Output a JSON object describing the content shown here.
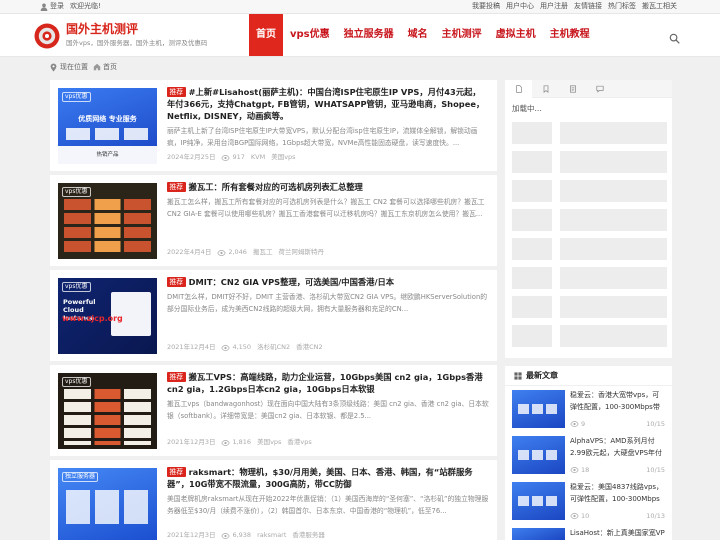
{
  "colors": {
    "accent": "#d7261b",
    "nav_active_bg": "#e0271d",
    "badge_bg": "#d9251c"
  },
  "topbar": {
    "login": "登录",
    "welcome": "欢迎光临!",
    "links": [
      "我要投稿",
      "用户中心",
      "用户注册",
      "友情链接",
      "热门标签",
      "搬瓦工相关"
    ]
  },
  "site": {
    "title": "国外主机测评",
    "subtitle": "国外vps，国外服务器，国外主机，测评及优惠码"
  },
  "nav": [
    "首页",
    "vps优惠",
    "独立服务器",
    "域名",
    "主机测评",
    "虚拟主机",
    "主机教程"
  ],
  "breadcrumb": {
    "label": "现在位置",
    "home": "首页"
  },
  "posts": [
    {
      "badge": "推荐",
      "title": "#上新#Lisahost(丽萨主机)：中国台湾ISP住宅原生IP VPS，月付43元起，年付366元，支持Chatgpt, FB管钥，WHATSAPP管钥，亚马逊电商，Shopee，Netflix, DISNEY，动画疯等。",
      "excerpt": "丽萨主机上新了台湾ISP住宅原生IP大带宽VPS，默认分配台湾isp住宅原生IP，流媒体全解锁，解锁动画疯，IP纯净，采用台湾BGP国际网络，1Gbps超大带宽，NVMe高性能固态硬盘，读写速度快。...",
      "date": "2024年2月25日",
      "views": "917",
      "tags": [
        "KVM",
        "美国vps"
      ],
      "thumb": {
        "label": "vps优惠",
        "headline": "优质网络 专业服务",
        "footer": "热销产品"
      }
    },
    {
      "badge": "推荐",
      "title": "搬瓦工：所有套餐对应的可选机房列表汇总整理",
      "excerpt": "搬瓦工怎么样，搬瓦工所有套餐对应的可选机房列表是什么？搬瓦工 CN2 套餐可以选择哪些机房？搬瓦工 CN2 GIA-E 套餐可以使用哪些机房？搬瓦工香港套餐可以迁移机房吗？搬瓦工东京机房怎么使用？搬瓦...",
      "date": "2022年4月4日",
      "views": "2,046",
      "tags": [
        "搬瓦工",
        "荷兰阿姆斯特丹"
      ],
      "thumb": {
        "label": "vps优惠"
      }
    },
    {
      "badge": "推荐",
      "title": "DMIT：CN2 GIA VPS整理，可选美国/中国香港/日本",
      "excerpt": "DMIT怎么样，DMIT好不好，DMIT 主营香港、洛杉矶大带宽CN2 GIA VPS。继欧鹏HKServerSolution的部分国际业务后，成为美西CN2线路的超级大网，拥有大量服务器和充足的CN...",
      "date": "2021年12月4日",
      "views": "4,150",
      "tags": [
        "洛杉矶CN2",
        "香港CN2"
      ],
      "thumb": {
        "label": "vps优惠",
        "headline": "Powerful Cloud Instance",
        "url": "www.zjcp.org"
      }
    },
    {
      "badge": "推荐",
      "title": "搬瓦工VPS：高端线路，助力企业运营，10Gbps美国 cn2 gia，1Gbps香港cn2 gia，1.2Gbps日本cn2 gia，10Gbps日本软银",
      "excerpt": "搬瓦工vps（bandwagonhost）现在面向中国大陆有3条顶级线路：美国 cn2 gia、香港 cn2 gia、日本软银（softbank）。详细带宽是：美国cn2 gia、日本软银、都是2.5...",
      "date": "2021年12月3日",
      "views": "1,816",
      "tags": [
        "美国vps",
        "香港vps"
      ],
      "thumb": {
        "label": "vps优惠"
      }
    },
    {
      "badge": "推荐",
      "title": "raksmart：物理机，$30/月用美，美国、日本、香港、韩国，有“站群服务器”，10G带宽不限流量，300G高防，带CC防御",
      "excerpt": "美国老牌机房raksmart从现在开始2022年优惠促销：（1）美国西海岸的“圣何塞”、“洛杉矶”的独立物理服务器低至$30/月（续费不涨价），（2）韩国首尔、日本东京、中国香港的“物理机”，低至76...",
      "date": "2021年12月3日",
      "views": "6,938",
      "tags": [
        "raksmart",
        "香港服务器"
      ],
      "thumb": {
        "label": "独立服务器"
      }
    }
  ],
  "sidebar": {
    "tab_icons": [
      "document-icon",
      "bookmark-icon",
      "file-icon",
      "comment-icon"
    ],
    "loading": "加载中...",
    "latest_title": "最新文章",
    "latest": [
      {
        "title": "稳爱云：香港大宽带vps，可弹性配置，100-300Mbps带宽...",
        "views": "9",
        "date": "10/15"
      },
      {
        "title": "AlphaVPS：AMD系列月付2.99欧元起，大硬盘VPS年付1...",
        "views": "18",
        "date": "10/15"
      },
      {
        "title": "稳爱云：美国4837线路vps，可弹性配置，100-300Mbps带宽...",
        "views": "10",
        "date": "10/13"
      },
      {
        "title": "LisaHost：新上真美国家宽VP"
      }
    ]
  }
}
